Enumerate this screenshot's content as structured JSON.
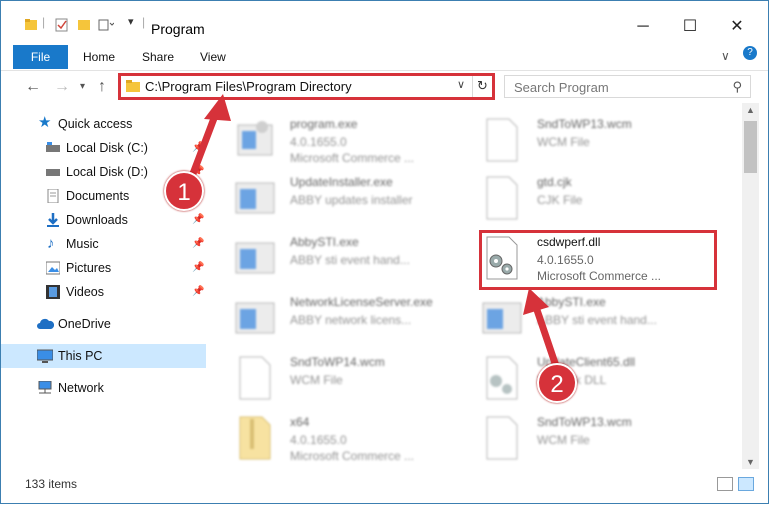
{
  "window": {
    "title": "Program"
  },
  "ribbon": {
    "file": "File",
    "home": "Home",
    "share": "Share",
    "view": "View"
  },
  "address": {
    "path": "C:\\Program Files\\Program Directory",
    "search_placeholder": "Search Program"
  },
  "sidebar": {
    "items": [
      {
        "label": "Quick access",
        "icon": "star-icon"
      },
      {
        "label": "Local Disk (C:)",
        "icon": "drive-icon"
      },
      {
        "label": "Local Disk (D:)",
        "icon": "drive-icon"
      },
      {
        "label": "Documents",
        "icon": "documents-icon"
      },
      {
        "label": "Downloads",
        "icon": "downloads-icon"
      },
      {
        "label": "Music",
        "icon": "music-icon"
      },
      {
        "label": "Pictures",
        "icon": "pictures-icon"
      },
      {
        "label": "Videos",
        "icon": "videos-icon"
      },
      {
        "label": "OneDrive",
        "icon": "cloud-icon"
      },
      {
        "label": "This PC",
        "icon": "pc-icon"
      },
      {
        "label": "Network",
        "icon": "network-icon"
      }
    ]
  },
  "files": [
    {
      "name": "program.exe",
      "sub1": "4.0.1655.0",
      "sub2": "Microsoft Commerce ..."
    },
    {
      "name": "SndToWP13.wcm",
      "sub1": "WCM File",
      "sub2": ""
    },
    {
      "name": "UpdateInstaller.exe",
      "sub1": "ABBY updates installer",
      "sub2": ""
    },
    {
      "name": "gtd.cjk",
      "sub1": "CJK File",
      "sub2": ""
    },
    {
      "name": "AbbySTI.exe",
      "sub1": "ABBY sti event hand...",
      "sub2": ""
    },
    {
      "name": "csdwperf.dll",
      "sub1": "4.0.1655.0",
      "sub2": "Microsoft Commerce ..."
    },
    {
      "name": "NetworkLicenseServer.exe",
      "sub1": "ABBY network licens...",
      "sub2": ""
    },
    {
      "name": "AbbySTI.exe",
      "sub1": "ABBY sti event hand...",
      "sub2": ""
    },
    {
      "name": "SndToWP14.wcm",
      "sub1": "WCM File",
      "sub2": ""
    },
    {
      "name": "UpdateClient65.dll",
      "sub1": "Network DLL",
      "sub2": ""
    },
    {
      "name": "x64",
      "sub1": "4.0.1655.0",
      "sub2": "Microsoft Commerce ..."
    },
    {
      "name": "SndToWP13.wcm",
      "sub1": "WCM File",
      "sub2": ""
    }
  ],
  "status": {
    "items": "133 items"
  },
  "callouts": {
    "one": "1",
    "two": "2"
  },
  "colors": {
    "accent": "#1979ca",
    "highlight": "#d6323a",
    "selected": "#cce8ff"
  }
}
